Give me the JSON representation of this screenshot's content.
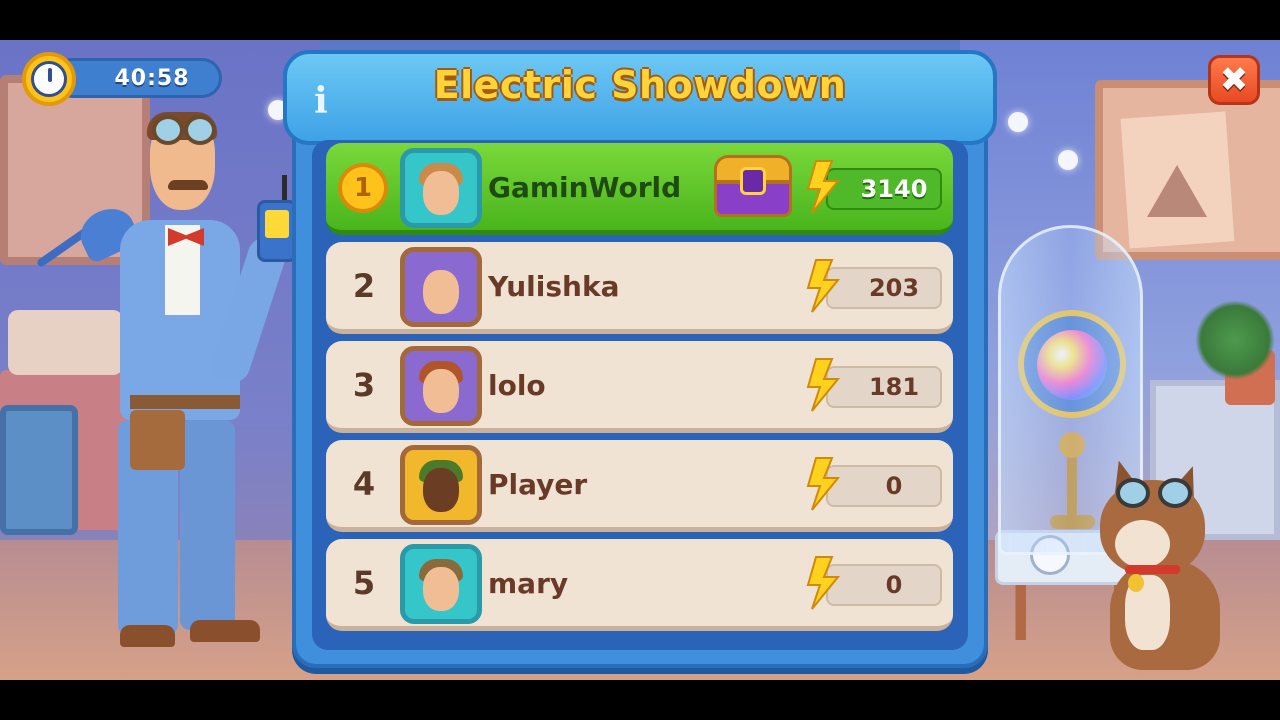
{
  "hud": {
    "timer": "40:58",
    "close_icon": "✖"
  },
  "panel": {
    "title": "Electric Showdown",
    "info_icon": "i"
  },
  "leaderboard": [
    {
      "rank": "1",
      "name": "GaminWorld",
      "score": "3140",
      "has_chest": true,
      "highlight": true
    },
    {
      "rank": "2",
      "name": "Yulishka",
      "score": "203",
      "has_chest": false,
      "highlight": false
    },
    {
      "rank": "3",
      "name": "lolo",
      "score": "181",
      "has_chest": false,
      "highlight": false
    },
    {
      "rank": "4",
      "name": "Player",
      "score": "0",
      "has_chest": false,
      "highlight": false
    },
    {
      "rank": "5",
      "name": "mary",
      "score": "0",
      "has_chest": false,
      "highlight": false
    }
  ],
  "colors": {
    "title": "#ffd43a",
    "first_row": "#49b51c",
    "row": "#f1e3d3",
    "bolt": "#ffd21f",
    "close": "#e84a23"
  },
  "icons": {
    "bolt": "lightning-bolt-icon",
    "chest": "treasure-chest-icon",
    "timer": "stopwatch-icon",
    "close": "close-icon",
    "info": "info-icon"
  }
}
